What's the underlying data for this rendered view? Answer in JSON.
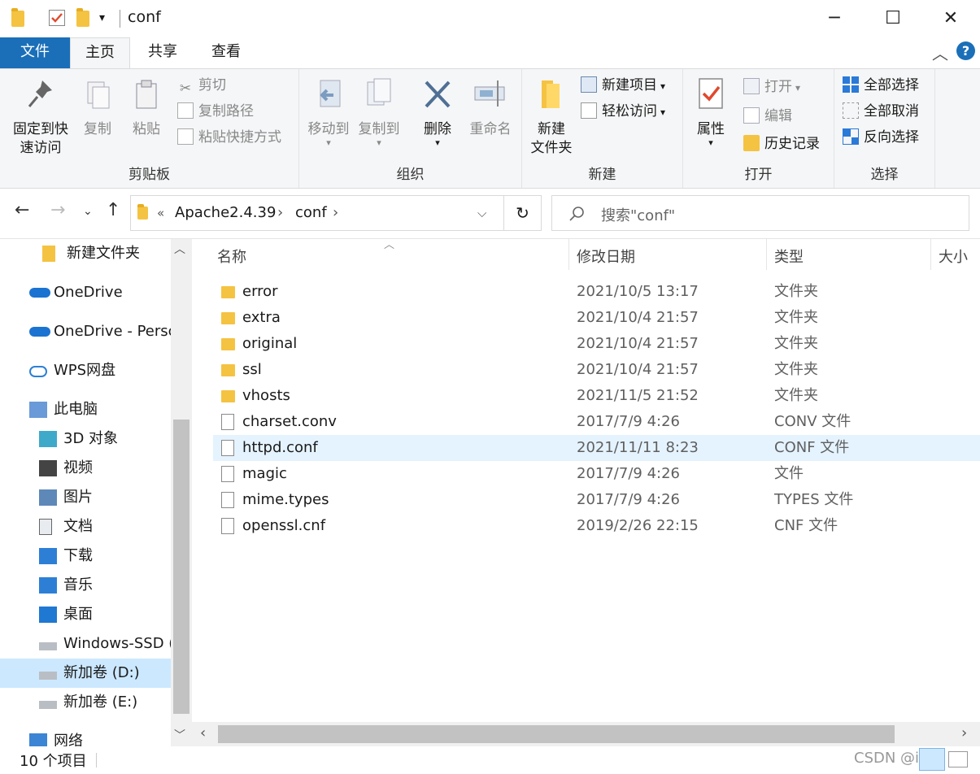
{
  "window": {
    "title": "conf",
    "minimize": "─",
    "maximize": "☐",
    "close": "✕"
  },
  "tabs": {
    "file": "文件",
    "home": "主页",
    "share": "共享",
    "view": "查看"
  },
  "ribbon": {
    "clipboard": {
      "label": "剪贴板",
      "pin_line1": "固定到快",
      "pin_line2": "速访问",
      "copy": "复制",
      "paste": "粘贴",
      "cut": "剪切",
      "copy_path": "复制路径",
      "paste_shortcut": "粘贴快捷方式"
    },
    "organize": {
      "label": "组织",
      "move_to": "移动到",
      "copy_to": "复制到",
      "delete": "删除",
      "rename": "重命名"
    },
    "new": {
      "label": "新建",
      "new_folder_line1": "新建",
      "new_folder_line2": "文件夹",
      "new_item": "新建项目",
      "easy_access": "轻松访问"
    },
    "open": {
      "label": "打开",
      "properties": "属性",
      "open": "打开",
      "edit": "编辑",
      "history": "历史记录"
    },
    "select": {
      "label": "选择",
      "select_all": "全部选择",
      "select_none": "全部取消",
      "invert": "反向选择"
    }
  },
  "address": {
    "overflow": "«",
    "crumbs": [
      "Apache2.4.39",
      "conf"
    ],
    "search_placeholder": "搜索\"conf\""
  },
  "nav_items": [
    {
      "label": "新建文件夹",
      "icon": "folder-icon"
    },
    {
      "label": "OneDrive",
      "icon": "cloud-icon"
    },
    {
      "label": "OneDrive - Persc",
      "icon": "cloud-icon"
    },
    {
      "label": "WPS网盘",
      "icon": "cloud-outline-icon"
    },
    {
      "label": "此电脑",
      "icon": "computer-icon"
    },
    {
      "label": "3D 对象",
      "icon": "cube-icon"
    },
    {
      "label": "视频",
      "icon": "film-icon"
    },
    {
      "label": "图片",
      "icon": "picture-icon"
    },
    {
      "label": "文档",
      "icon": "document-icon"
    },
    {
      "label": "下载",
      "icon": "download-icon"
    },
    {
      "label": "音乐",
      "icon": "music-icon"
    },
    {
      "label": "桌面",
      "icon": "desktop-icon"
    },
    {
      "label": "Windows-SSD (",
      "icon": "drive-icon"
    },
    {
      "label": "新加卷 (D:)",
      "icon": "drive-icon"
    },
    {
      "label": "新加卷 (E:)",
      "icon": "drive-icon"
    },
    {
      "label": "网络",
      "icon": "network-icon"
    }
  ],
  "columns": {
    "name": "名称",
    "date": "修改日期",
    "type": "类型",
    "size": "大小"
  },
  "files": [
    {
      "name": "error",
      "date": "2021/10/5 13:17",
      "type": "文件夹",
      "kind": "folder"
    },
    {
      "name": "extra",
      "date": "2021/10/4 21:57",
      "type": "文件夹",
      "kind": "folder"
    },
    {
      "name": "original",
      "date": "2021/10/4 21:57",
      "type": "文件夹",
      "kind": "folder"
    },
    {
      "name": "ssl",
      "date": "2021/10/4 21:57",
      "type": "文件夹",
      "kind": "folder"
    },
    {
      "name": "vhosts",
      "date": "2021/11/5 21:52",
      "type": "文件夹",
      "kind": "folder"
    },
    {
      "name": "charset.conv",
      "date": "2017/7/9 4:26",
      "type": "CONV 文件",
      "kind": "file"
    },
    {
      "name": "httpd.conf",
      "date": "2021/11/11 8:23",
      "type": "CONF 文件",
      "kind": "file"
    },
    {
      "name": "magic",
      "date": "2017/7/9 4:26",
      "type": "文件",
      "kind": "file"
    },
    {
      "name": "mime.types",
      "date": "2017/7/9 4:26",
      "type": "TYPES 文件",
      "kind": "file"
    },
    {
      "name": "openssl.cnf",
      "date": "2019/2/26 22:15",
      "type": "CNF 文件",
      "kind": "file"
    }
  ],
  "status": {
    "item_count": "10 个项目",
    "watermark": "CSDN @ing"
  }
}
